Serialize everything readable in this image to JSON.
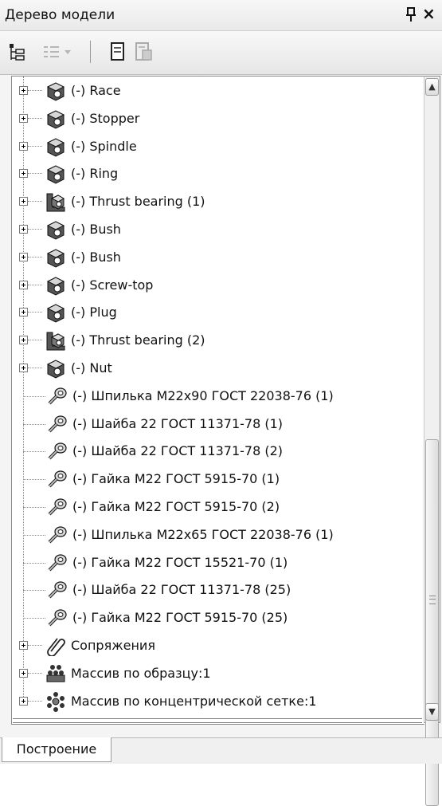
{
  "window": {
    "title": "Дерево модели",
    "pin_icon": "pin-icon",
    "close_glyph": "×"
  },
  "toolbar": {
    "buttons": [
      "tree-structure-icon",
      "list-view-dropdown-icon",
      "page-icon",
      "page-properties-icon"
    ]
  },
  "tree": {
    "items": [
      {
        "label": "(-) Race",
        "icon": "part-icon",
        "expandable": true
      },
      {
        "label": "(-) Stopper",
        "icon": "part-icon",
        "expandable": true
      },
      {
        "label": "(-) Spindle",
        "icon": "part-icon",
        "expandable": true
      },
      {
        "label": "(-) Ring",
        "icon": "part-icon",
        "expandable": true
      },
      {
        "label": "(-) Thrust bearing (1)",
        "icon": "subassembly-icon",
        "expandable": true
      },
      {
        "label": "(-) Bush",
        "icon": "part-icon",
        "expandable": true
      },
      {
        "label": "(-) Bush",
        "icon": "part-icon",
        "expandable": true
      },
      {
        "label": "(-) Screw-top",
        "icon": "part-icon",
        "expandable": true
      },
      {
        "label": "(-) Plug",
        "icon": "part-icon",
        "expandable": true
      },
      {
        "label": "(-) Thrust bearing (2)",
        "icon": "subassembly-icon",
        "expandable": true
      },
      {
        "label": "(-) Nut",
        "icon": "part-icon",
        "expandable": true
      },
      {
        "label": "(-) Шпилька М22х90 ГОСТ 22038-76 (1)",
        "icon": "standard-part-icon",
        "expandable": false
      },
      {
        "label": "(-) Шайба 22 ГОСТ 11371-78 (1)",
        "icon": "standard-part-icon",
        "expandable": false
      },
      {
        "label": "(-) Шайба 22 ГОСТ 11371-78 (2)",
        "icon": "standard-part-icon",
        "expandable": false
      },
      {
        "label": "(-) Гайка М22 ГОСТ 5915-70 (1)",
        "icon": "standard-part-icon",
        "expandable": false
      },
      {
        "label": "(-) Гайка М22 ГОСТ 5915-70 (2)",
        "icon": "standard-part-icon",
        "expandable": false
      },
      {
        "label": "(-) Шпилька М22х65 ГОСТ 22038-76 (1)",
        "icon": "standard-part-icon",
        "expandable": false
      },
      {
        "label": "(-) Гайка М22 ГОСТ 15521-70 (1)",
        "icon": "standard-part-icon",
        "expandable": false
      },
      {
        "label": "(-) Шайба 22 ГОСТ 11371-78 (25)",
        "icon": "standard-part-icon",
        "expandable": false
      },
      {
        "label": "(-) Гайка М22 ГОСТ 5915-70 (25)",
        "icon": "standard-part-icon",
        "expandable": false
      },
      {
        "label": "Сопряжения",
        "icon": "paperclip-icon",
        "expandable": true
      },
      {
        "label": "Массив по образцу:1",
        "icon": "pattern-array-icon",
        "expandable": true
      },
      {
        "label": "Массив по концентрической сетке:1",
        "icon": "circular-array-icon",
        "expandable": true
      }
    ]
  },
  "tabs": [
    {
      "label": "Построение"
    }
  ]
}
